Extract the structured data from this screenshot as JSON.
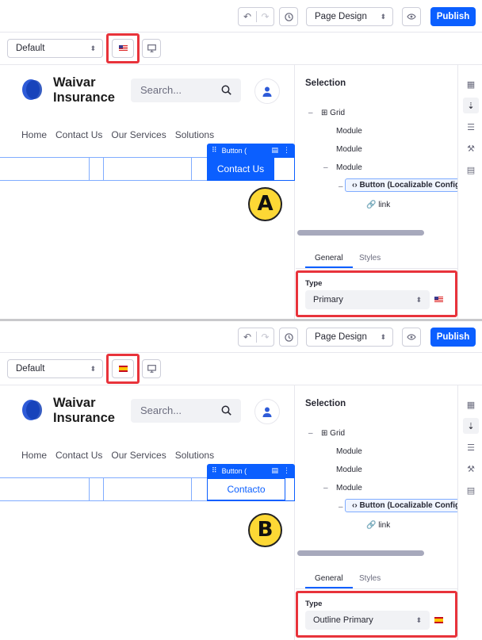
{
  "panels": [
    {
      "id": "a",
      "toolbar": {
        "undo_icon": "↶",
        "redo_icon": "↷",
        "page_design": "Page Design",
        "publish": "Publish"
      },
      "bar2": {
        "experience": "Default",
        "flag": "us"
      },
      "site": {
        "brand_line1": "Waivar",
        "brand_line2": "Insurance",
        "search_placeholder": "Search...",
        "nav": [
          "Home",
          "Contact Us",
          "Our Services",
          "Solutions"
        ],
        "topper_label": "Button (",
        "button_text": "Contact Us",
        "button_style": "primary",
        "badge": "A"
      },
      "sidebar": {
        "heading": "Selection",
        "tree": {
          "grid": "Grid",
          "module1": "Module",
          "module2": "Module",
          "module3": "Module",
          "button_node": "Button (Localizable Configu",
          "link": "link"
        },
        "tabs": {
          "general": "General",
          "styles": "Styles"
        },
        "type_label": "Type",
        "type_value": "Primary",
        "type_flag": "us"
      }
    },
    {
      "id": "b",
      "toolbar": {
        "undo_icon": "↶",
        "redo_icon": "↷",
        "page_design": "Page Design",
        "publish": "Publish"
      },
      "bar2": {
        "experience": "Default",
        "flag": "es"
      },
      "site": {
        "brand_line1": "Waivar",
        "brand_line2": "Insurance",
        "search_placeholder": "Search...",
        "nav": [
          "Home",
          "Contact Us",
          "Our Services",
          "Solutions"
        ],
        "topper_label": "Button (",
        "button_text": "Contacto",
        "button_style": "outline",
        "badge": "B"
      },
      "sidebar": {
        "heading": "Selection",
        "tree": {
          "grid": "Grid",
          "module1": "Module",
          "module2": "Module",
          "module3": "Module",
          "button_node": "Button (Localizable Configu",
          "link": "link"
        },
        "tabs": {
          "general": "General",
          "styles": "Styles"
        },
        "type_label": "Type",
        "type_value": "Outline Primary",
        "type_flag": "es"
      }
    }
  ],
  "icons": {
    "history": "clock-icon",
    "preview": "eye-icon",
    "device": "desktop-icon",
    "search": "magnifier-icon",
    "user": "user-icon",
    "drag": "drag-handle-icon",
    "comment": "comment-icon",
    "more": "kebab-icon",
    "rail": [
      "widgets-icon",
      "browser-icon",
      "page-structure-icon",
      "paint-icon",
      "comments-icon"
    ]
  },
  "colors": {
    "accent": "#0b5fff",
    "highlight": "#e8333b",
    "badge": "#fdd835"
  }
}
